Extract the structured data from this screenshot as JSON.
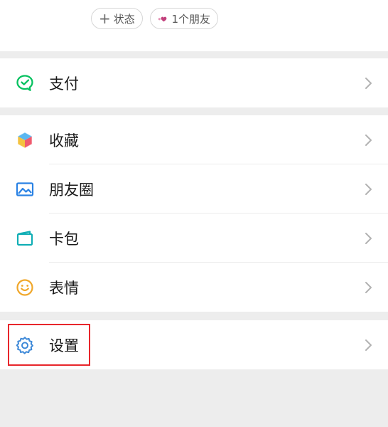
{
  "status_bar": {
    "add_status_label": "状态",
    "friends_label": "1个朋友"
  },
  "menu": {
    "pay": "支付",
    "favorites": "收藏",
    "moments": "朋友圈",
    "cards": "卡包",
    "stickers": "表情",
    "settings": "设置"
  },
  "colors": {
    "pay_green": "#07c160",
    "moments_blue": "#2a82e4",
    "cards_teal": "#10aeb5",
    "stickers_orange": "#f0a72a",
    "settings_blue": "#3e89d8",
    "highlight_red": "#e8262b"
  }
}
